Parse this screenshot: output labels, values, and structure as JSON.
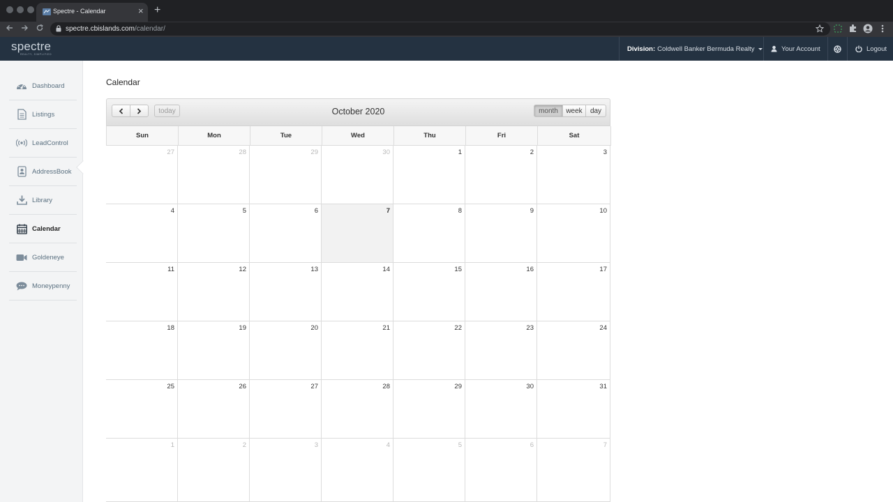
{
  "browser": {
    "tab_title": "Spectre - Calendar",
    "tab_close": "×",
    "new_tab": "+",
    "url_host": "spectre.cbislands.com",
    "url_path": "/calendar/"
  },
  "header": {
    "logo_text": "spectre",
    "logo_tagline": "REALTY, SIMPLIFIED",
    "division_label": "Division:",
    "division_value": "Coldwell Banker Bermuda Realty",
    "account_label": "Your Account",
    "logout_label": "Logout"
  },
  "sidebar": {
    "items": [
      {
        "label": "Dashboard",
        "icon": "dashboard-gauge-icon"
      },
      {
        "label": "Listings",
        "icon": "document-icon"
      },
      {
        "label": "LeadControl",
        "icon": "broadcast-icon"
      },
      {
        "label": "AddressBook",
        "icon": "address-book-icon"
      },
      {
        "label": "Library",
        "icon": "download-icon"
      },
      {
        "label": "Calendar",
        "icon": "calendar-icon",
        "active": true
      },
      {
        "label": "Goldeneye",
        "icon": "video-camera-icon"
      },
      {
        "label": "Moneypenny",
        "icon": "chat-bubble-icon"
      }
    ]
  },
  "main": {
    "page_title": "Calendar"
  },
  "calendar": {
    "title": "October 2020",
    "today_label": "today",
    "prev_symbol": "‹",
    "next_symbol": "›",
    "view_buttons": [
      "month",
      "week",
      "day"
    ],
    "active_view": "month",
    "weekdays": [
      "Sun",
      "Mon",
      "Tue",
      "Wed",
      "Thu",
      "Fri",
      "Sat"
    ],
    "today_date": "7",
    "weeks": [
      [
        {
          "d": "27",
          "o": true
        },
        {
          "d": "28",
          "o": true
        },
        {
          "d": "29",
          "o": true
        },
        {
          "d": "30",
          "o": true
        },
        {
          "d": "1"
        },
        {
          "d": "2"
        },
        {
          "d": "3"
        }
      ],
      [
        {
          "d": "4"
        },
        {
          "d": "5"
        },
        {
          "d": "6"
        },
        {
          "d": "7",
          "t": true
        },
        {
          "d": "8"
        },
        {
          "d": "9"
        },
        {
          "d": "10"
        }
      ],
      [
        {
          "d": "11"
        },
        {
          "d": "12"
        },
        {
          "d": "13"
        },
        {
          "d": "14"
        },
        {
          "d": "15"
        },
        {
          "d": "16"
        },
        {
          "d": "17"
        }
      ],
      [
        {
          "d": "18"
        },
        {
          "d": "19"
        },
        {
          "d": "20"
        },
        {
          "d": "21"
        },
        {
          "d": "22"
        },
        {
          "d": "23"
        },
        {
          "d": "24"
        }
      ],
      [
        {
          "d": "25"
        },
        {
          "d": "26"
        },
        {
          "d": "27"
        },
        {
          "d": "28"
        },
        {
          "d": "29"
        },
        {
          "d": "30"
        },
        {
          "d": "31"
        }
      ],
      [
        {
          "d": "1",
          "o": true
        },
        {
          "d": "2",
          "o": true
        },
        {
          "d": "3",
          "o": true
        },
        {
          "d": "4",
          "o": true
        },
        {
          "d": "5",
          "o": true
        },
        {
          "d": "6",
          "o": true
        },
        {
          "d": "7",
          "o": true
        }
      ]
    ]
  }
}
